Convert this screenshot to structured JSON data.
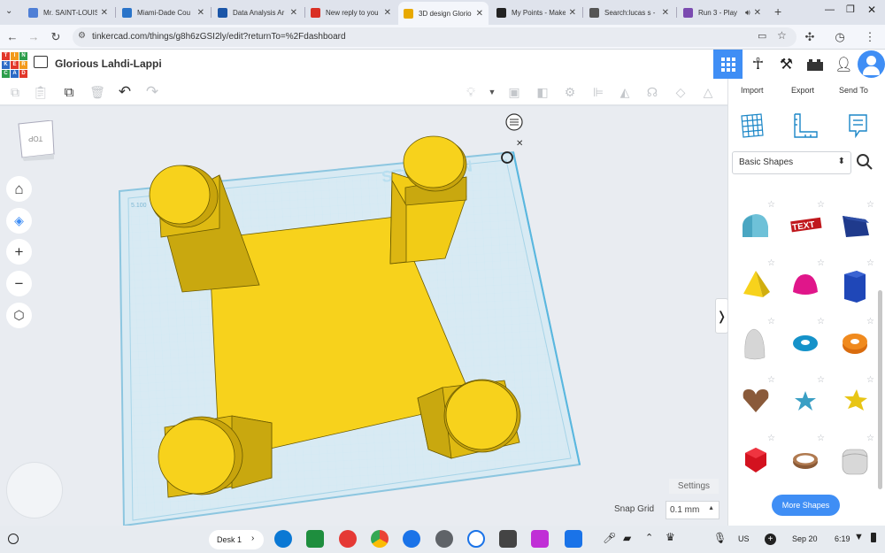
{
  "browser": {
    "tabs": [
      {
        "title": "Mr. SAINT-LOUIS",
        "color": "#4f7fd6"
      },
      {
        "title": "Miami-Dade Cou",
        "color": "#2a74c9"
      },
      {
        "title": "Data Analysis Ar",
        "color": "#1b56a8"
      },
      {
        "title": "New reply to you",
        "color": "#d93025"
      },
      {
        "title": "3D design Glorio",
        "color": "#e8a900"
      },
      {
        "title": "My Points - Make",
        "color": "#222222"
      },
      {
        "title": "Search:lucas s -",
        "color": "#555555"
      },
      {
        "title": "Run 3 - Play",
        "color": "#7b4bb0"
      }
    ],
    "url": "tinkercad.com/things/g8h6zGSI2ly/edit?returnTo=%2Fdashboard"
  },
  "header": {
    "logo_letters": [
      "T",
      "I",
      "N",
      "K",
      "E",
      "R",
      "C",
      "A",
      "D"
    ],
    "design_name": "Glorious Lahdi-Lappi"
  },
  "panel": {
    "actions": [
      "Import",
      "Export",
      "Send To"
    ],
    "library": "Basic Shapes",
    "more_shapes": "More Shapes"
  },
  "canvas": {
    "view_cube": "TOP",
    "settings": "Settings",
    "snap_grid_label": "Snap Grid",
    "snap_grid_value": "0.1 mm"
  },
  "taskbar": {
    "desk": "Desk 1",
    "lang": "US",
    "date": "Sep 20",
    "time": "6:19"
  },
  "colors": {
    "accent": "#3f8ef5",
    "shape_yellow": "#f7d21c",
    "grid": "#cfe7f3"
  }
}
